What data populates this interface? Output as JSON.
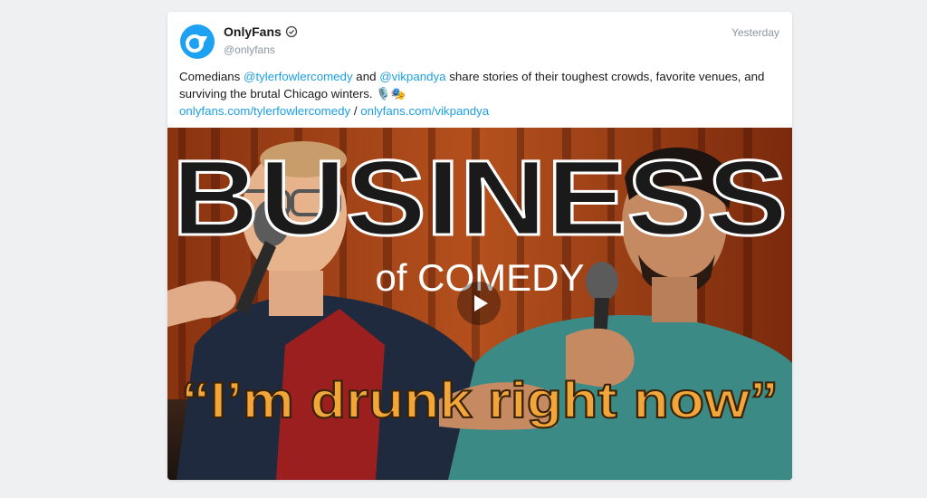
{
  "post": {
    "author_name": "OnlyFans",
    "author_handle": "@onlyfans",
    "timestamp": "Yesterday",
    "text": {
      "part1": "Comedians ",
      "mention1": "@tylerfowlercomedy",
      "part2": " and ",
      "mention2": "@vikpandya",
      "part3": " share stories of their toughest crowds, favorite venues, and surviving the brutal Chicago winters. 🎙️🎭",
      "link1": "onlyfans.com/tylerfowlercomedy",
      "sep": " / ",
      "link2": "onlyfans.com/vikpandya"
    }
  },
  "video": {
    "title_top": "BUSINESS",
    "title_sub": "of COMEDY",
    "caption": "“I’m drunk right now”"
  },
  "colors": {
    "link": "#1ca0e3",
    "brand": "#1da1f2",
    "muted": "#8a96a3",
    "caption_orange": "#f2a63a"
  },
  "icons": {
    "avatar": "onlyfans-logo-icon",
    "verified": "verified-badge-icon",
    "play": "play-icon"
  }
}
